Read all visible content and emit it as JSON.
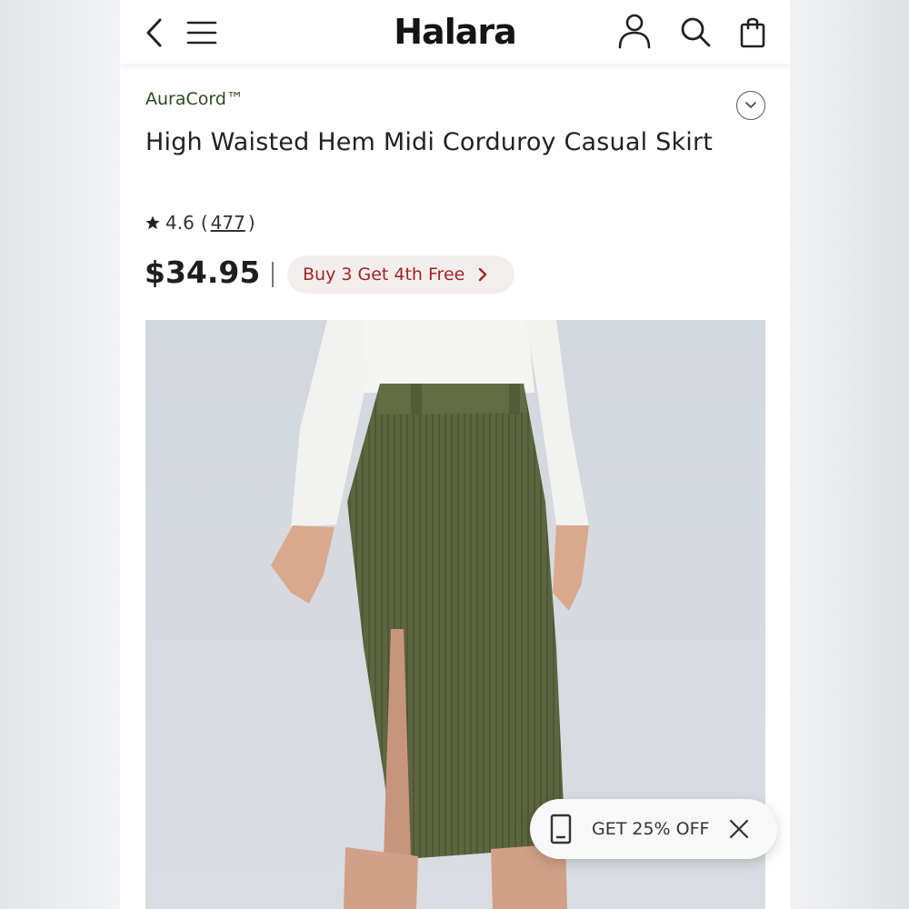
{
  "header": {
    "logo": "Halara",
    "icons": [
      "back-chevron-icon",
      "hamburger-menu-icon",
      "account-icon",
      "search-icon",
      "shopping-bag-icon"
    ]
  },
  "product": {
    "brand": "AuraCord™",
    "title": "High Waisted Hem Midi Corduroy Casual Skirt",
    "rating": "4.6",
    "rating_open": "(",
    "review_count": "477",
    "rating_close": ")",
    "price": "$34.95",
    "promo": "Buy 3 Get 4th Free"
  },
  "popup": {
    "label": "GET 25% OFF"
  },
  "colors": {
    "brand_green": "#2e4a1f",
    "promo_red": "#a32423",
    "promo_bg": "#f3eeee",
    "skirt_olive": "#5e6640"
  }
}
